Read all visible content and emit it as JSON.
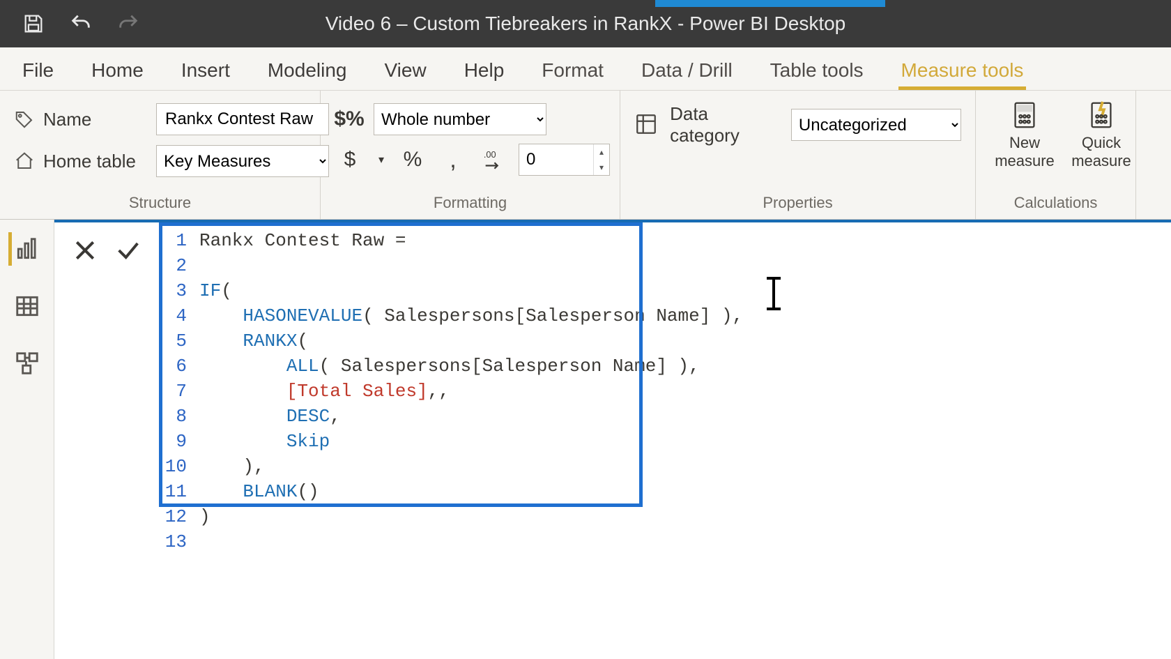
{
  "titlebar": {
    "title": "Video 6 – Custom Tiebreakers in RankX - Power BI Desktop"
  },
  "menu": {
    "items": [
      "File",
      "Home",
      "Insert",
      "Modeling",
      "View",
      "Help",
      "Format",
      "Data / Drill",
      "Table tools",
      "Measure tools"
    ],
    "active_index": 9
  },
  "ribbon": {
    "structure": {
      "name_label": "Name",
      "name_value": "Rankx Contest Raw",
      "home_table_label": "Home table",
      "home_table_value": "Key Measures",
      "group_label": "Structure"
    },
    "formatting": {
      "format_value": "Whole number",
      "decimals_value": "0",
      "group_label": "Formatting"
    },
    "properties": {
      "label": "Data category",
      "value": "Uncategorized",
      "group_label": "Properties"
    },
    "calculations": {
      "new_measure": "New\nmeasure",
      "quick_measure": "Quick\nmeasure",
      "group_label": "Calculations"
    }
  },
  "editor": {
    "line_numbers": [
      "1",
      "2",
      "3",
      "4",
      "5",
      "6",
      "7",
      "8",
      "9",
      "10",
      "11",
      "12",
      "13"
    ],
    "code_lines": [
      {
        "indent": 0,
        "tokens": [
          {
            "t": "Rankx Contest Raw =",
            "c": "ref"
          }
        ]
      },
      {
        "indent": 0,
        "tokens": []
      },
      {
        "indent": 0,
        "tokens": [
          {
            "t": "IF",
            "c": "func"
          },
          {
            "t": "(",
            "c": "punc"
          }
        ]
      },
      {
        "indent": 1,
        "tokens": [
          {
            "t": "HASONEVALUE",
            "c": "func"
          },
          {
            "t": "( Salespersons[Salesperson Name] ),",
            "c": "ref"
          }
        ]
      },
      {
        "indent": 1,
        "tokens": [
          {
            "t": "RANKX",
            "c": "func"
          },
          {
            "t": "(",
            "c": "punc"
          }
        ]
      },
      {
        "indent": 2,
        "tokens": [
          {
            "t": "ALL",
            "c": "func"
          },
          {
            "t": "( Salespersons[Salesperson Name] ),",
            "c": "ref"
          }
        ]
      },
      {
        "indent": 2,
        "tokens": [
          {
            "t": "[Total Sales]",
            "c": "meas"
          },
          {
            "t": ",,",
            "c": "punc"
          }
        ]
      },
      {
        "indent": 2,
        "tokens": [
          {
            "t": "DESC",
            "c": "func"
          },
          {
            "t": ",",
            "c": "punc"
          }
        ]
      },
      {
        "indent": 2,
        "tokens": [
          {
            "t": "Skip",
            "c": "func"
          }
        ]
      },
      {
        "indent": 1,
        "tokens": [
          {
            "t": "),",
            "c": "punc"
          }
        ]
      },
      {
        "indent": 1,
        "tokens": [
          {
            "t": "BLANK",
            "c": "func"
          },
          {
            "t": "()",
            "c": "punc"
          }
        ]
      },
      {
        "indent": 0,
        "tokens": [
          {
            "t": ")",
            "c": "punc"
          }
        ]
      },
      {
        "indent": 0,
        "tokens": []
      }
    ]
  }
}
